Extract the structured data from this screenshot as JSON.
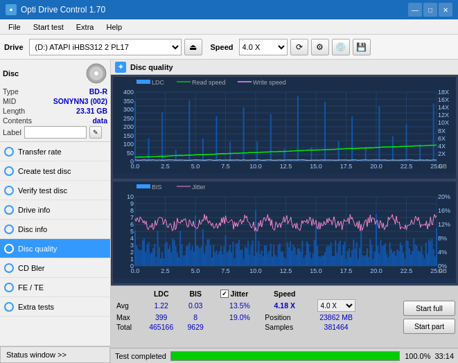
{
  "titleBar": {
    "title": "Opti Drive Control 1.70",
    "minBtn": "—",
    "maxBtn": "□",
    "closeBtn": "✕"
  },
  "menuBar": {
    "items": [
      "File",
      "Start test",
      "Extra",
      "Help"
    ]
  },
  "toolbar": {
    "driveLabel": "Drive",
    "driveValue": "(D:) ATAPI iHBS312  2 PL17",
    "speedLabel": "Speed",
    "speedValue": "4.0 X"
  },
  "disc": {
    "title": "Disc",
    "typeLabel": "Type",
    "typeValue": "BD-R",
    "midLabel": "MID",
    "midValue": "SONYNN3 (002)",
    "lengthLabel": "Length",
    "lengthValue": "23.31 GB",
    "contentsLabel": "Contents",
    "contentsValue": "data",
    "labelLabel": "Label"
  },
  "navItems": [
    {
      "label": "Transfer rate",
      "active": false
    },
    {
      "label": "Create test disc",
      "active": false
    },
    {
      "label": "Verify test disc",
      "active": false
    },
    {
      "label": "Drive info",
      "active": false
    },
    {
      "label": "Disc info",
      "active": false
    },
    {
      "label": "Disc quality",
      "active": true
    },
    {
      "label": "CD Bler",
      "active": false
    },
    {
      "label": "FE / TE",
      "active": false
    },
    {
      "label": "Extra tests",
      "active": false
    }
  ],
  "statusWindow": "Status window >>",
  "qualityHeader": "Disc quality",
  "legend": {
    "ldc": "LDC",
    "readSpeed": "Read speed",
    "writeSpeed": "Write speed",
    "bis": "BIS",
    "jitter": "Jitter"
  },
  "stats": {
    "headers": [
      "LDC",
      "BIS",
      "",
      "Jitter",
      "Speed",
      ""
    ],
    "avgLabel": "Avg",
    "avgLdc": "1.22",
    "avgBis": "0.03",
    "avgJitter": "13.5%",
    "avgSpeed": "4.18 X",
    "avgSpeedSet": "4.0 X",
    "maxLabel": "Max",
    "maxLdc": "399",
    "maxBis": "8",
    "maxJitter": "19.0%",
    "posLabel": "Position",
    "posValue": "23862 MB",
    "totalLabel": "Total",
    "totalLdc": "465166",
    "totalBis": "9629",
    "samplesLabel": "Samples",
    "samplesValue": "381464",
    "startFullBtn": "Start full",
    "startPartBtn": "Start part"
  },
  "progress": {
    "statusText": "Test completed",
    "percent": "100.0%",
    "time": "33:14"
  }
}
